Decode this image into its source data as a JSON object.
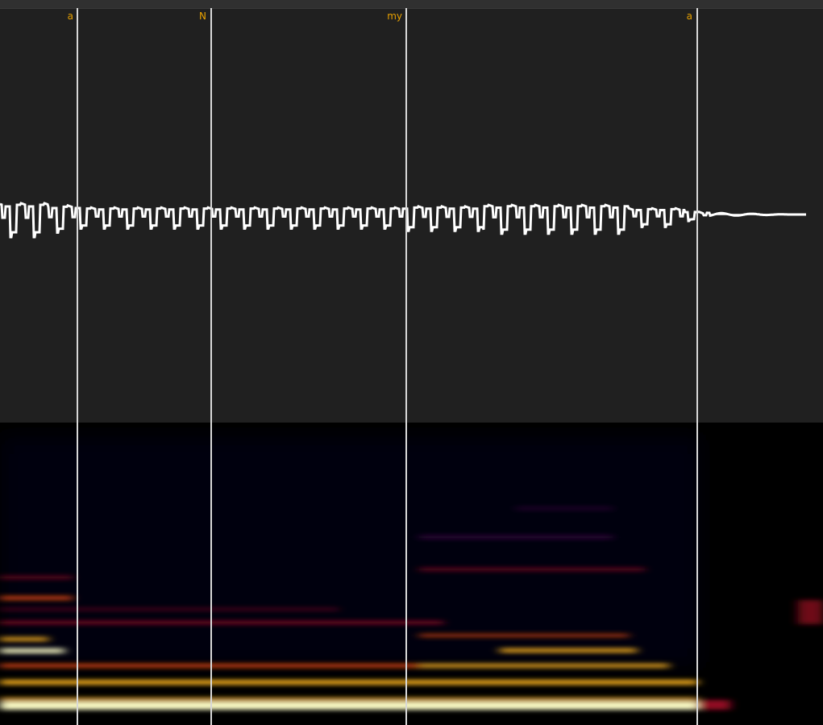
{
  "segments": [
    {
      "label": "a"
    },
    {
      "label": "N"
    },
    {
      "label": "my"
    },
    {
      "label": "a"
    }
  ],
  "colors": {
    "background": "#202020",
    "waveform": "#ffffff",
    "boundary_line": "#d8d8d8",
    "phoneme_label": "#e8a100",
    "spectrogram_background": "#000000",
    "spectrogram_colormap": [
      "#000000",
      "#140a45",
      "#5b0f5e",
      "#b8142a",
      "#ee4a10",
      "#ffb520",
      "#ffffc8"
    ]
  }
}
